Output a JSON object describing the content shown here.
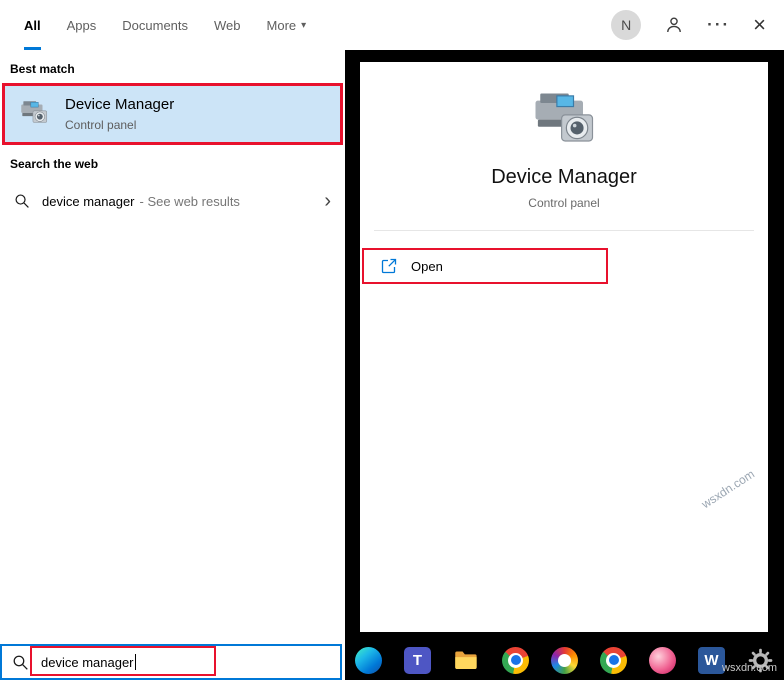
{
  "tabs": [
    {
      "label": "All",
      "active": true
    },
    {
      "label": "Apps",
      "active": false
    },
    {
      "label": "Documents",
      "active": false
    },
    {
      "label": "Web",
      "active": false
    },
    {
      "label": "More",
      "active": false,
      "has_dropdown": true
    }
  ],
  "topbar": {
    "avatar_letter": "N"
  },
  "icons": {
    "dropdown_arrow": "▾",
    "more_options": "···",
    "close": "×",
    "chevron_right": "›",
    "teams_letter": "T",
    "word_letter": "W"
  },
  "left_panel": {
    "best_match_label": "Best match",
    "best_match": {
      "title": "Device Manager",
      "subtitle": "Control panel"
    },
    "search_web_label": "Search the web",
    "web_suggestion": {
      "query": "device manager",
      "suffix": "- See web results"
    }
  },
  "preview": {
    "title": "Device Manager",
    "subtitle": "Control panel",
    "actions": [
      {
        "label": "Open"
      }
    ]
  },
  "search_box": {
    "value": "device manager"
  },
  "watermark": "wsxdn.com",
  "colors": {
    "accent": "#0078d7",
    "highlight": "#cce4f7",
    "annotation_red": "#e8112d",
    "taskbar_bg": "#000000"
  }
}
